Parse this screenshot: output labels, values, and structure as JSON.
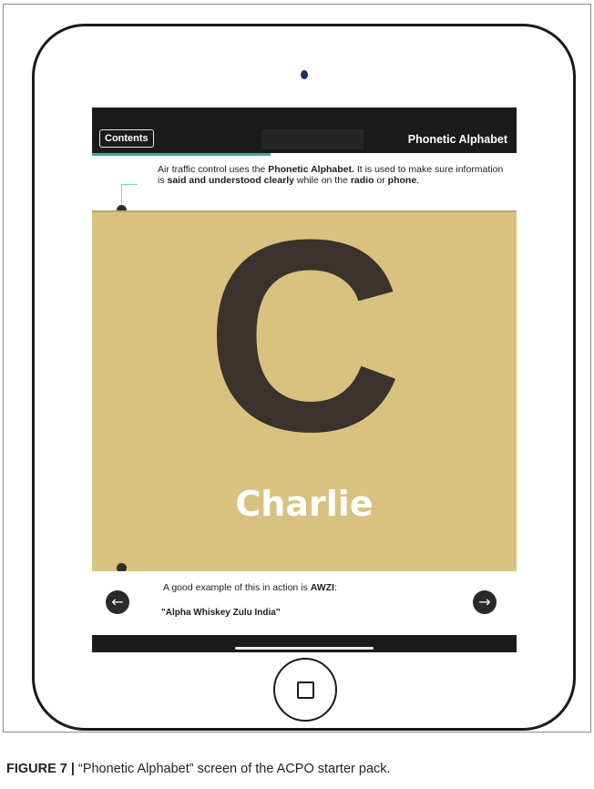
{
  "app": {
    "contents_label": "Contents",
    "title": "Phonetic Alphabet",
    "progress_fraction": 0.42
  },
  "intro": {
    "t1": "Air traffic control uses the ",
    "b1": "Phonetic Alphabet.",
    "t2": " It is used to make sure information is ",
    "b2": "said and understood clearly",
    "t3": " while on the ",
    "b3": "radio",
    "t4": " or ",
    "b4": "phone",
    "t5": "."
  },
  "card": {
    "letter": "C",
    "word": "Charlie",
    "background": "#d9c27f",
    "letter_color": "#3a332d"
  },
  "example": {
    "prefix": "A good example of this in action is ",
    "code": "AWZI",
    "suffix": ":",
    "quote": "\"Alpha Whiskey Zulu India\""
  },
  "nav": {
    "back_icon": "arrow-left-icon",
    "back_glyph": "←",
    "next_icon": "arrow-right-icon",
    "next_glyph": "→"
  },
  "caption": {
    "label": "FIGURE 7 |",
    "text": " “Phonetic Alphabet” screen of the ACPO starter pack."
  }
}
